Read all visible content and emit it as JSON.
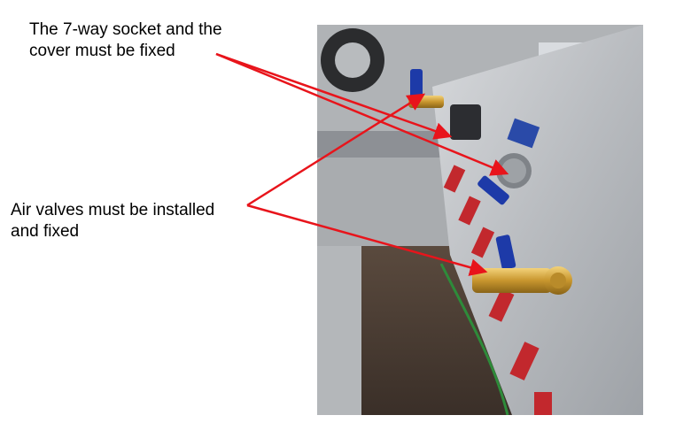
{
  "annotations": {
    "socket_label": "The 7-way socket and the\ncover must be fixed",
    "valves_label": "Air valves must be installed\nand fixed"
  },
  "colors": {
    "arrow": "#e8141b",
    "text": "#000000"
  },
  "photo": {
    "subject": "trailer-side-panel-with-brass-air-valves-and-7-way-socket"
  }
}
